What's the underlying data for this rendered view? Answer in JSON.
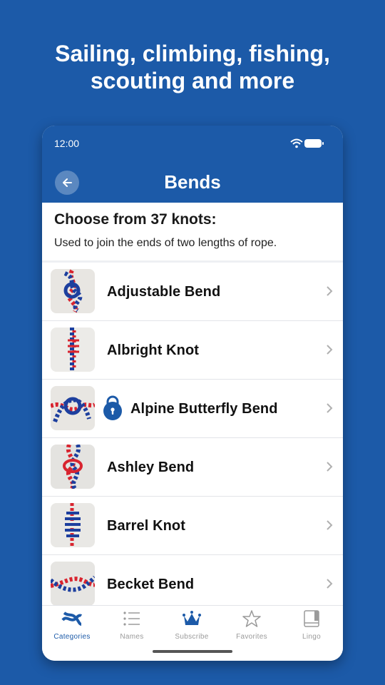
{
  "headline": "Sailing, climbing, fishing, scouting and more",
  "status": {
    "time": "12:00"
  },
  "header": {
    "title": "Bends"
  },
  "intro": {
    "title": "Choose from 37 knots:",
    "subtitle": "Used to join the ends of two lengths of rope."
  },
  "knots": [
    {
      "name": "Adjustable Bend",
      "locked": false
    },
    {
      "name": "Albright Knot",
      "locked": false
    },
    {
      "name": "Alpine Butterfly Bend",
      "locked": true
    },
    {
      "name": "Ashley Bend",
      "locked": false
    },
    {
      "name": "Barrel Knot",
      "locked": false
    },
    {
      "name": "Becket Bend",
      "locked": false
    }
  ],
  "tabs": [
    {
      "label": "Categories",
      "icon": "knot-icon",
      "active": true
    },
    {
      "label": "Names",
      "icon": "list-icon",
      "active": false
    },
    {
      "label": "Subscribe",
      "icon": "crown-icon",
      "active": false
    },
    {
      "label": "Favorites",
      "icon": "star-icon",
      "active": false
    },
    {
      "label": "Lingo",
      "icon": "book-icon",
      "active": false
    }
  ],
  "colors": {
    "brand": "#1c5aa8",
    "rope_red": "#d8242f",
    "rope_blue": "#1d3f9e",
    "inactive": "#9a9a9a"
  }
}
